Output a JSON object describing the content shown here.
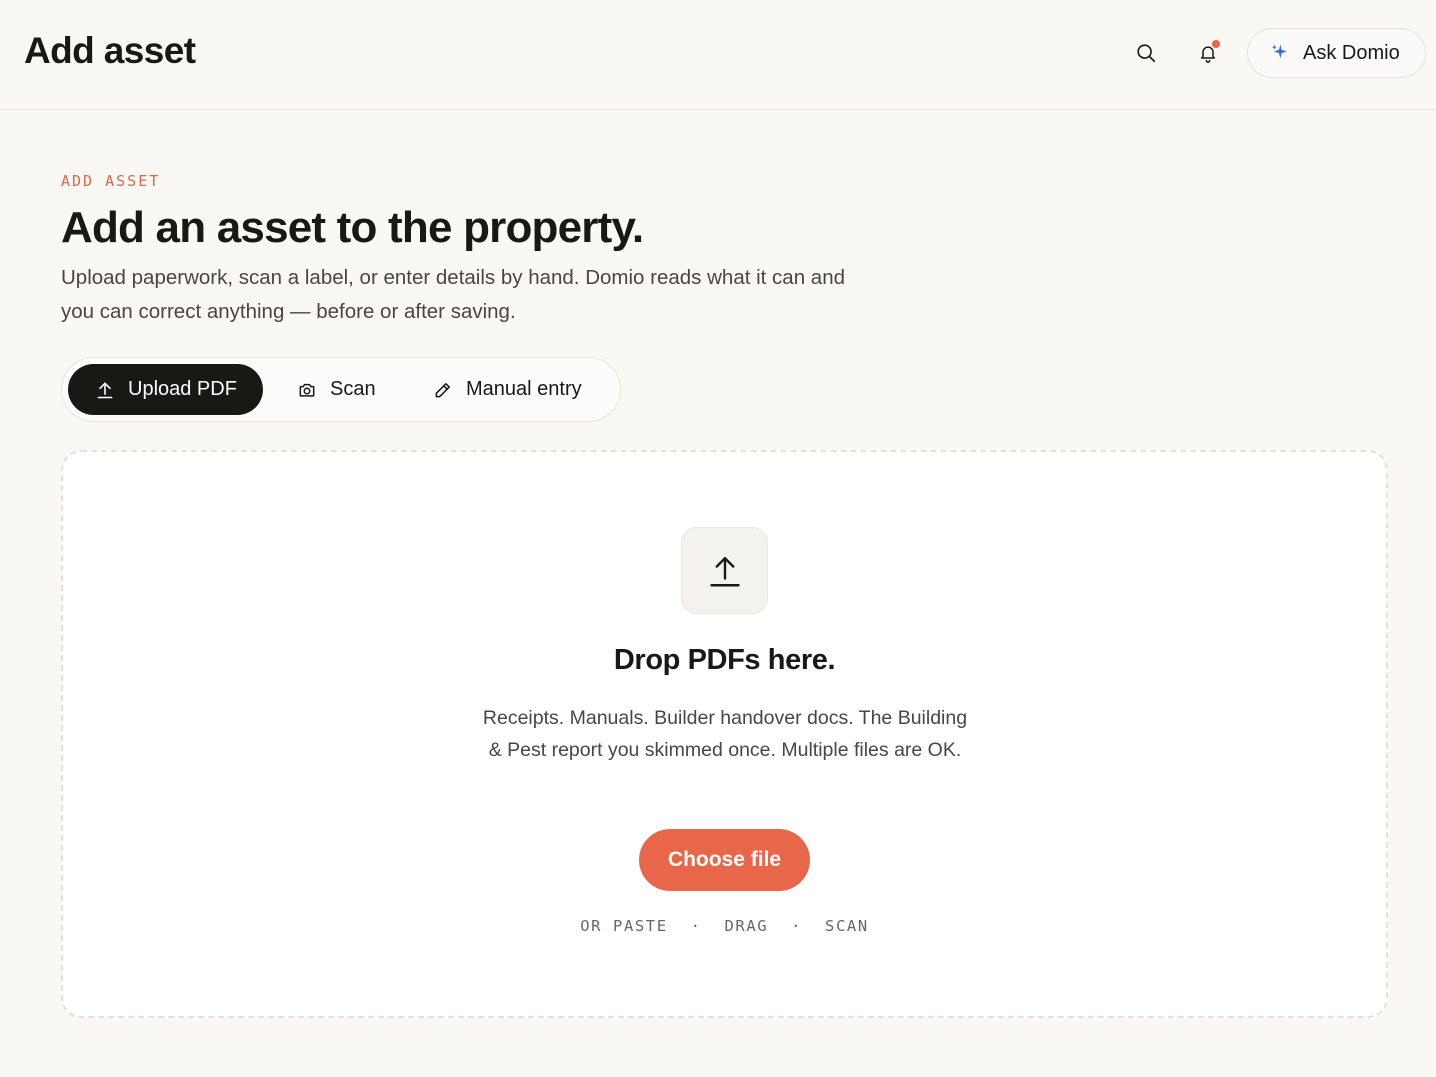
{
  "header": {
    "title": "Add asset",
    "ask_label": "Ask Domio",
    "icons": [
      "search-icon",
      "bell-icon",
      "sparkle-icon"
    ],
    "notification_dot_color": "#e8674a"
  },
  "intro": {
    "eyebrow": "ADD ASSET",
    "headline": "Add an asset to the property.",
    "description": "Upload paperwork, scan a label, or enter details by hand. Domio reads what it can and you can correct anything — before or after saving."
  },
  "tabs": [
    {
      "label": "Upload PDF",
      "icon": "upload-icon",
      "active": true
    },
    {
      "label": "Scan",
      "icon": "camera-icon",
      "active": false
    },
    {
      "label": "Manual entry",
      "icon": "pencil-icon",
      "active": false
    }
  ],
  "dropzone": {
    "icon": "upload-arrow-icon",
    "title": "Drop PDFs here.",
    "description": "Receipts. Manuals. Builder handover docs. The Building & Pest report you skimmed once. Multiple files are OK.",
    "button_label": "Choose file",
    "alt_options": [
      "OR PASTE",
      "DRAG",
      "SCAN"
    ],
    "alt_separator": "·"
  },
  "colors": {
    "accent": "#e8674a",
    "dark": "#1a1815",
    "background": "#f9f8f5"
  }
}
